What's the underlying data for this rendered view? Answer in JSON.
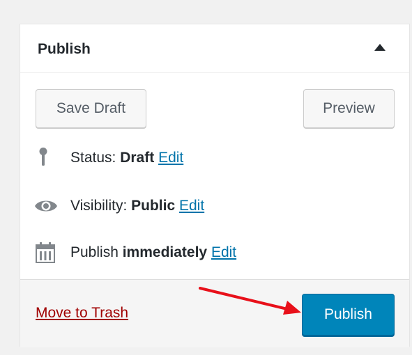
{
  "publish_box": {
    "title": "Publish",
    "save_draft_label": "Save Draft",
    "preview_label": "Preview",
    "status": {
      "label": "Status: ",
      "value": "Draft",
      "edit_label": "Edit",
      "icon": "pin-icon"
    },
    "visibility": {
      "label": "Visibility: ",
      "value": "Public",
      "edit_label": "Edit",
      "icon": "eye-icon"
    },
    "schedule": {
      "label": "Publish ",
      "value": "immediately",
      "edit_label": "Edit",
      "icon": "calendar-icon"
    },
    "trash_label": "Move to Trash",
    "publish_label": "Publish"
  },
  "colors": {
    "publish_button": "#0085ba",
    "link": "#0073aa",
    "trash_link": "#a00000",
    "annotation_arrow": "#e8101a"
  }
}
